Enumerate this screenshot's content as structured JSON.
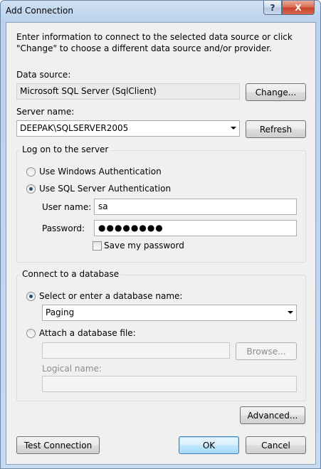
{
  "window": {
    "title": "Add Connection",
    "help_glyph": "?",
    "close_glyph": "X"
  },
  "intro_text": "Enter information to connect to the selected data source or click \"Change\" to choose a different data source and/or provider.",
  "data_source": {
    "label": "Data source:",
    "value": "Microsoft SQL Server (SqlClient)",
    "change_button": "Change..."
  },
  "server": {
    "label": "Server name:",
    "value": "DEEPAK\\SQLSERVER2005",
    "refresh_button": "Refresh"
  },
  "logon": {
    "group_title": "Log on to the server",
    "windows_auth": "Use Windows Authentication",
    "sql_auth": "Use SQL Server Authentication",
    "selected": "sql_auth",
    "username_label": "User name:",
    "username_value": "sa",
    "password_label": "Password:",
    "password_value": "●●●●●●●●",
    "save_password_label": "Save my password",
    "save_password_checked": false
  },
  "database": {
    "group_title": "Connect to a database",
    "select_option": "Select or enter a database name:",
    "select_value": "Paging",
    "attach_option": "Attach a database file:",
    "browse_button": "Browse...",
    "logical_name_label": "Logical name:",
    "selected": "select"
  },
  "buttons": {
    "advanced": "Advanced...",
    "test_connection": "Test Connection",
    "ok": "OK",
    "cancel": "Cancel"
  }
}
